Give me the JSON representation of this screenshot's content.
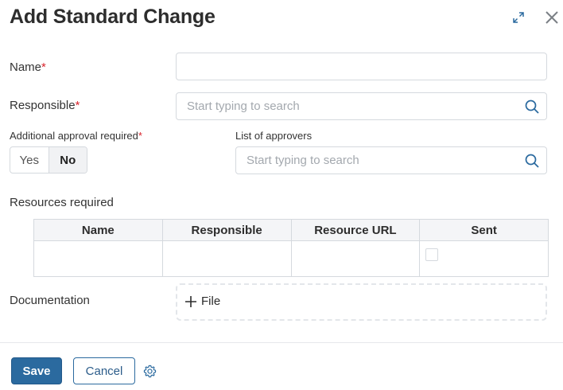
{
  "dialog": {
    "title": "Add Standard Change"
  },
  "form": {
    "name": {
      "label": "Name",
      "required_mark": "*",
      "value": ""
    },
    "responsible": {
      "label": "Responsible",
      "required_mark": "*",
      "placeholder": "Start typing to search"
    },
    "approval": {
      "label": "Additional approval required",
      "required_mark": "*",
      "options": [
        "Yes",
        "No"
      ],
      "selected": "No"
    },
    "approvers": {
      "label": "List of approvers",
      "placeholder": "Start typing to search"
    },
    "resources": {
      "label": "Resources required",
      "columns": [
        "Name",
        "Responsible",
        "Resource URL",
        "Sent"
      ],
      "rows": [
        {
          "name": "",
          "responsible": "",
          "resource_url": "",
          "sent": false
        }
      ]
    },
    "documentation": {
      "label": "Documentation",
      "add_file_label": "File"
    }
  },
  "footer": {
    "save_label": "Save",
    "cancel_label": "Cancel"
  },
  "icons": {
    "expand": "expand-icon",
    "close": "close-icon",
    "search": "search-icon",
    "plus": "plus-icon",
    "settings": "gear-icon"
  },
  "colors": {
    "primary": "#2b6a9f",
    "required": "#d9262e",
    "icon": "#2b6a9f"
  }
}
